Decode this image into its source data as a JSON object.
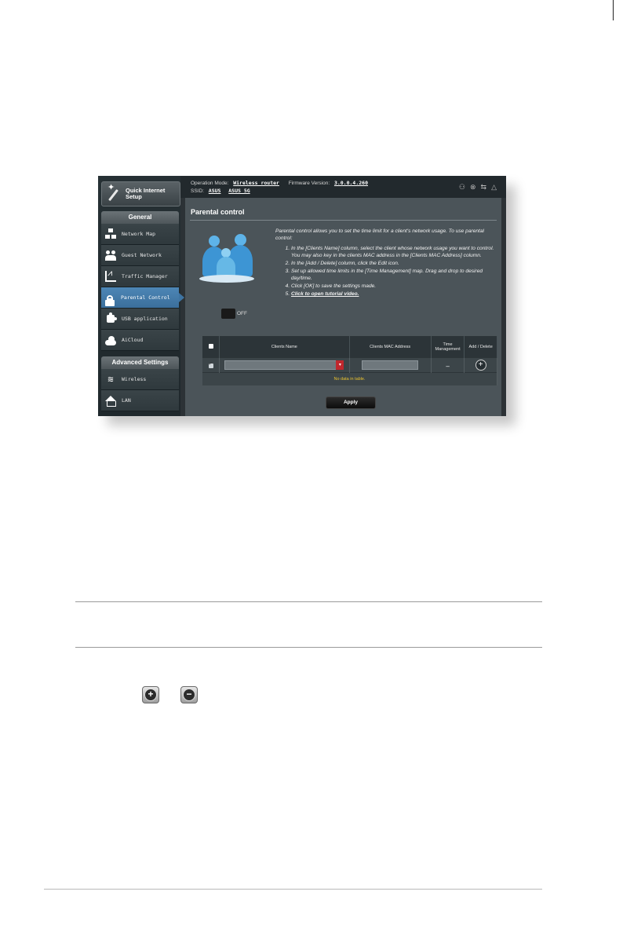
{
  "sidebar": {
    "quick_setup": "Quick Internet Setup",
    "general_header": "General",
    "general_items": [
      "Network Map",
      "Guest Network",
      "Traffic Manager",
      "Parental Control",
      "USB application",
      "AiCloud"
    ],
    "advanced_header": "Advanced Settings",
    "advanced_items": [
      "Wireless",
      "LAN"
    ]
  },
  "topbar": {
    "mode_label": "Operation Mode:",
    "mode_value": "Wireless router",
    "firmware_label": "Firmware Version:",
    "firmware_value": "3.0.0.4.260",
    "ssid_label": "SSID:",
    "ssid_1": "ASUS",
    "ssid_2": "ASUS_5G"
  },
  "panel": {
    "title": "Parental control",
    "toggle_label": "OFF",
    "intro": "Parental control allows you to set the time limit for a client's network usage. To use parental control:",
    "steps": [
      "In the [Clients Name] column, select the client whose network usage you want to control. You may also key in the clients MAC address in the [Clients MAC Address] column.",
      "In the [Add / Delete] column, click the Edit icon.",
      "Set up allowed time limits in the [Time Management] map. Drag and drop to desired day/time.",
      "Click [OK] to save the settings made.",
      "Click to open tutorial video."
    ],
    "table": {
      "headers": [
        "Clients Name",
        "Clients MAC Address",
        "Time Management",
        "Add / Delete"
      ],
      "row_dash": "–",
      "empty_text": "No data in table."
    },
    "apply_label": "Apply"
  },
  "icons": {
    "add": "+",
    "remove": "−"
  }
}
